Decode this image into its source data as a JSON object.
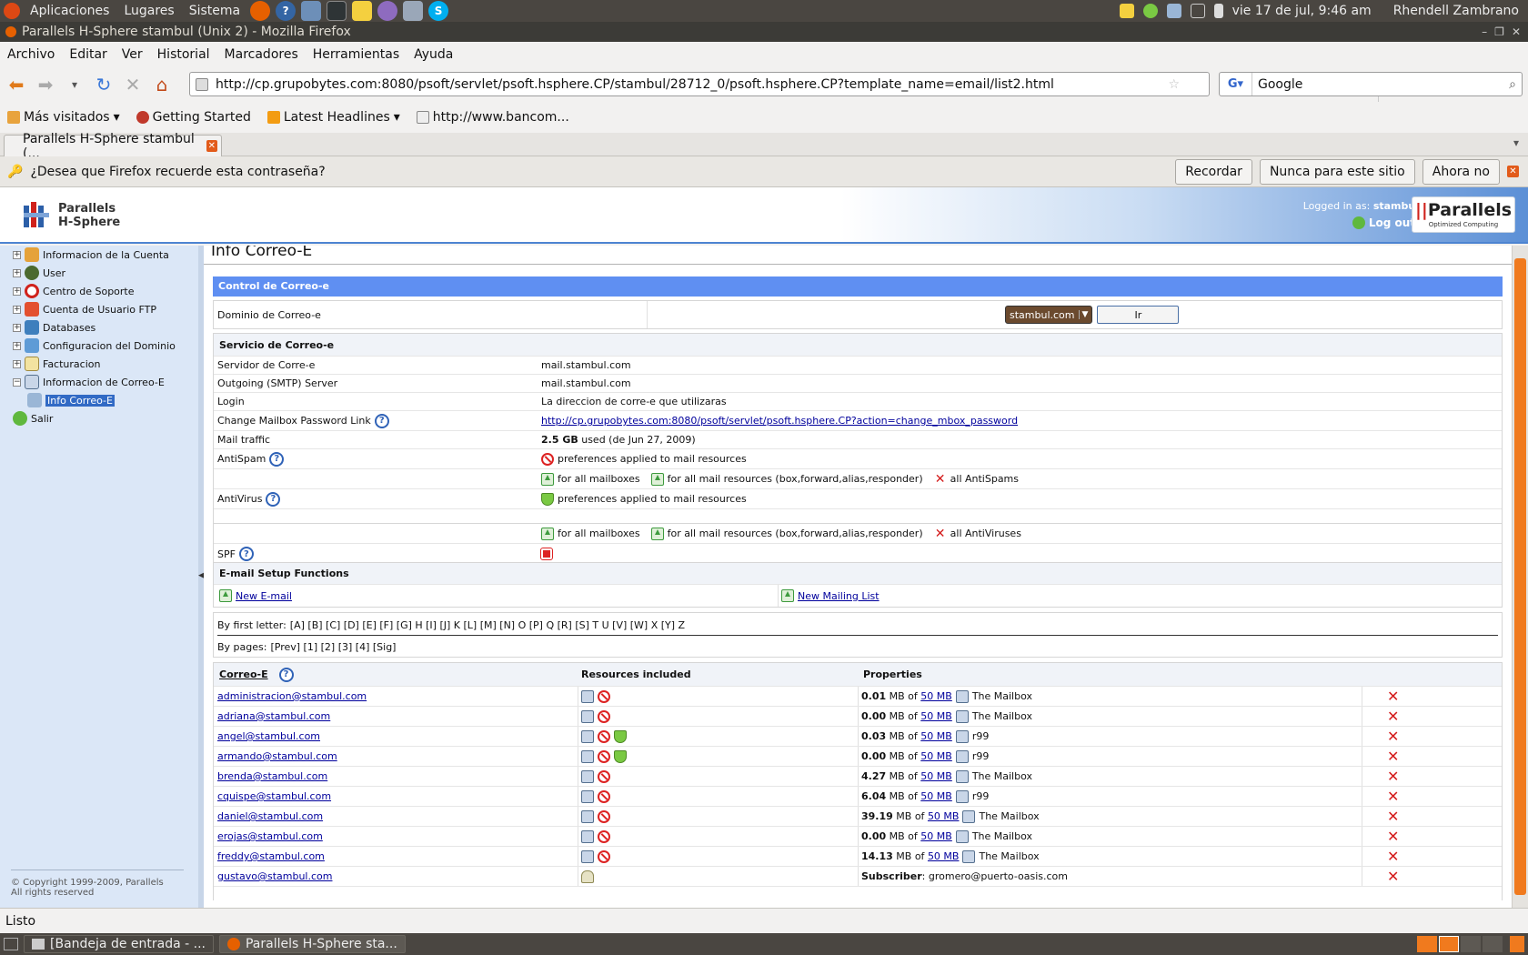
{
  "panel": {
    "menus": [
      "Aplicaciones",
      "Lugares",
      "Sistema"
    ],
    "clock": "vie 17 de jul,  9:46 am",
    "user": "Rhendell Zambrano"
  },
  "window": {
    "title": "Parallels H-Sphere stambul (Unix 2) - Mozilla Firefox"
  },
  "menubar": [
    "Archivo",
    "Editar",
    "Ver",
    "Historial",
    "Marcadores",
    "Herramientas",
    "Ayuda"
  ],
  "urlbar": {
    "url": "http://cp.grupobytes.com:8080/psoft/servlet/psoft.hsphere.CP/stambul/28712_0/psoft.hsphere.CP?template_name=email/list2.html"
  },
  "search": {
    "value": "Google"
  },
  "bookmarks": [
    "Más visitados",
    "Getting Started",
    "Latest Headlines",
    "http://www.bancom..."
  ],
  "tab": {
    "label": "Parallels H-Sphere stambul (..."
  },
  "notification": {
    "text": "¿Desea que Firefox recuerde esta contraseña?",
    "remember": "Recordar",
    "never": "Nunca para este sitio",
    "not_now": "Ahora no"
  },
  "hsphere": {
    "logo_line1": "Parallels",
    "logo_line2": "H-Sphere",
    "logged_label": "Logged in as: ",
    "logged_user": "stambul",
    "logout": "Log out",
    "brand": "Parallels",
    "brand_sub": "Optimized Computing"
  },
  "sidebar": {
    "items": [
      "Informacion de la Cuenta",
      "User",
      "Centro de Soporte",
      "Cuenta de Usuario FTP",
      "Databases",
      "Configuracion del Dominio",
      "Facturacion",
      "Informacion de Correo-E",
      "Info Correo-E",
      "Salir"
    ],
    "footer1": "© Copyright 1999-2009, Parallels",
    "footer2": "All rights reserved"
  },
  "page": {
    "title": "Info Correo-E",
    "control_header": "Control de Correo-e",
    "domain_label": "Dominio de Correo-e",
    "domain_value": "stambul.com",
    "go_button": "Ir",
    "service_header": "Servicio de Correo-e",
    "rows": {
      "server_label": "Servidor de Corre-e",
      "server_value": "mail.stambul.com",
      "smtp_label": "Outgoing (SMTP) Server",
      "smtp_value": "mail.stambul.com",
      "login_label": "Login",
      "login_value": "La direccion de corre-e que utilizaras",
      "pwlink_label": "Change Mailbox Password Link",
      "pwlink_value": "http://cp.grupobytes.com:8080/psoft/servlet/psoft.hsphere.CP?action=change_mbox_password",
      "traffic_label": "Mail traffic",
      "traffic_amount": "2.5 GB",
      "traffic_rest": " used (de Jun 27, 2009)",
      "antispam_label": "AntiSpam",
      "antispam_pref": "preferences applied to mail resources",
      "antispam_all_mb": "for all mailboxes",
      "antispam_all_res": "for all mail resources (box,forward,alias,responder)",
      "antispam_all_x": "all AntiSpams",
      "antivirus_label": "AntiVirus",
      "antivirus_pref": "preferences applied to mail resources",
      "antivirus_all_mb": "for all mailboxes",
      "antivirus_all_res": "for all mail resources (box,forward,alias,responder)",
      "antivirus_all_x": "all AntiViruses",
      "spf_label": "SPF"
    },
    "setup_header": "E-mail Setup Functions",
    "new_email": "New E-mail",
    "new_list": "New Mailing List",
    "letters_label": "By first letter:",
    "letters": "[A] [B] [C] [D] [E] [F] [G] H [I] [J] K [L] [M] [N] O [P] Q [R] [S] T U [V] [W] X [Y] Z",
    "pages_label": "By pages:",
    "pages": "[Prev] [1] [2] [3] [4] [Sig]",
    "col_email": "Correo-E",
    "col_resources": "Resources included",
    "col_properties": "Properties",
    "mailboxes": [
      {
        "email": "administracion@stambul.com",
        "used": "0.01",
        "quota": "50 MB",
        "name": "The Mailbox",
        "av": false
      },
      {
        "email": "adriana@stambul.com",
        "used": "0.00",
        "quota": "50 MB",
        "name": "The Mailbox",
        "av": false
      },
      {
        "email": "angel@stambul.com",
        "used": "0.03",
        "quota": "50 MB",
        "name": "r99",
        "av": true
      },
      {
        "email": "armando@stambul.com",
        "used": "0.00",
        "quota": "50 MB",
        "name": "r99",
        "av": true
      },
      {
        "email": "brenda@stambul.com",
        "used": "4.27",
        "quota": "50 MB",
        "name": "The Mailbox",
        "av": false
      },
      {
        "email": "cquispe@stambul.com",
        "used": "6.04",
        "quota": "50 MB",
        "name": "r99",
        "av": false
      },
      {
        "email": "daniel@stambul.com",
        "used": "39.19",
        "quota": "50 MB",
        "name": "The Mailbox",
        "av": false
      },
      {
        "email": "erojas@stambul.com",
        "used": "0.00",
        "quota": "50 MB",
        "name": "The Mailbox",
        "av": false
      },
      {
        "email": "freddy@stambul.com",
        "used": "14.13",
        "quota": "50 MB",
        "name": "The Mailbox",
        "av": false
      }
    ],
    "mb_of": " MB of ",
    "subscriber": {
      "email": "gustavo@stambul.com",
      "label": "Subscriber",
      "value": ": gromero@puerto-oasis.com"
    }
  },
  "statusbar": {
    "text": "Listo"
  },
  "taskbar": [
    "[Bandeja de entrada - ...",
    "Parallels H-Sphere sta..."
  ]
}
